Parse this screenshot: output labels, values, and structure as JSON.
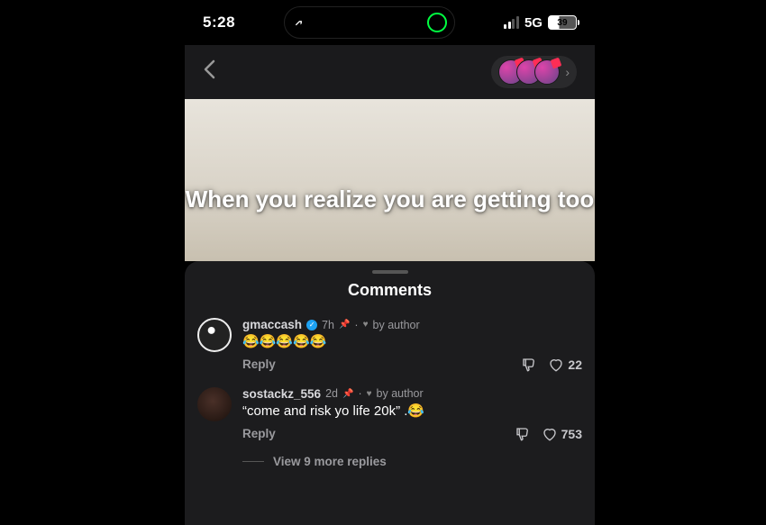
{
  "status": {
    "time": "5:28",
    "network": "5G",
    "battery": "39"
  },
  "video": {
    "overlay_text": "When you realize you are getting too"
  },
  "comments_sheet": {
    "title": "Comments"
  },
  "comments": [
    {
      "user": "gmaccash",
      "verified": true,
      "age": "7h",
      "pinned": true,
      "liked_by_author": true,
      "liked_label": "by author",
      "text": "😂😂😂😂😂",
      "likes": "22",
      "reply_label": "Reply"
    },
    {
      "user": "sostackz_556",
      "verified": false,
      "age": "2d",
      "pinned": true,
      "liked_by_author": true,
      "liked_label": "by author",
      "text": "“come and risk yo life 20k” .😂",
      "likes": "753",
      "reply_label": "Reply"
    }
  ],
  "view_more": "View 9 more replies",
  "annotation": {
    "color": "#d400ff"
  }
}
